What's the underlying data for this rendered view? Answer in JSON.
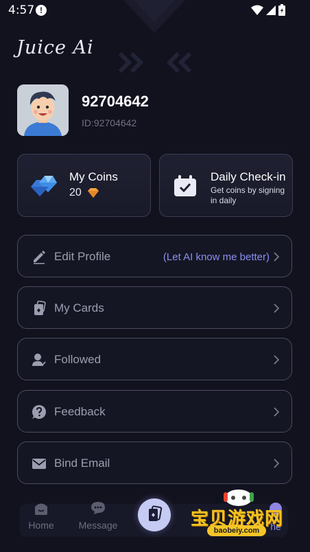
{
  "status_bar": {
    "time": "4:57",
    "alert_glyph": "!"
  },
  "app": {
    "logo": "Juice Ai"
  },
  "profile": {
    "username": "92704642",
    "id_text": "ID:92704642"
  },
  "coins_card": {
    "title": "My Coins",
    "value": "20"
  },
  "checkin_card": {
    "title": "Daily Check-in",
    "subtitle": "Get coins by signing in daily"
  },
  "menu": {
    "items": [
      {
        "label": "Edit Profile",
        "hint": "(Let AI know me better)",
        "icon": "pencil-icon"
      },
      {
        "label": "My Cards",
        "icon": "cards-icon"
      },
      {
        "label": "Followed",
        "icon": "user-follow-icon"
      },
      {
        "label": "Feedback",
        "icon": "question-icon"
      },
      {
        "label": "Bind Email",
        "icon": "mail-icon"
      }
    ]
  },
  "tabbar": {
    "home_label": "Home",
    "message_label": "Message",
    "partial_label_left": "S",
    "partial_label_right": "he"
  },
  "watermark": {
    "text": "宝贝游戏网",
    "url": "baobeiy.com"
  },
  "colors": {
    "background": "#12121f",
    "accent": "#8b8ff0",
    "center_button": "#c5cbf3"
  }
}
